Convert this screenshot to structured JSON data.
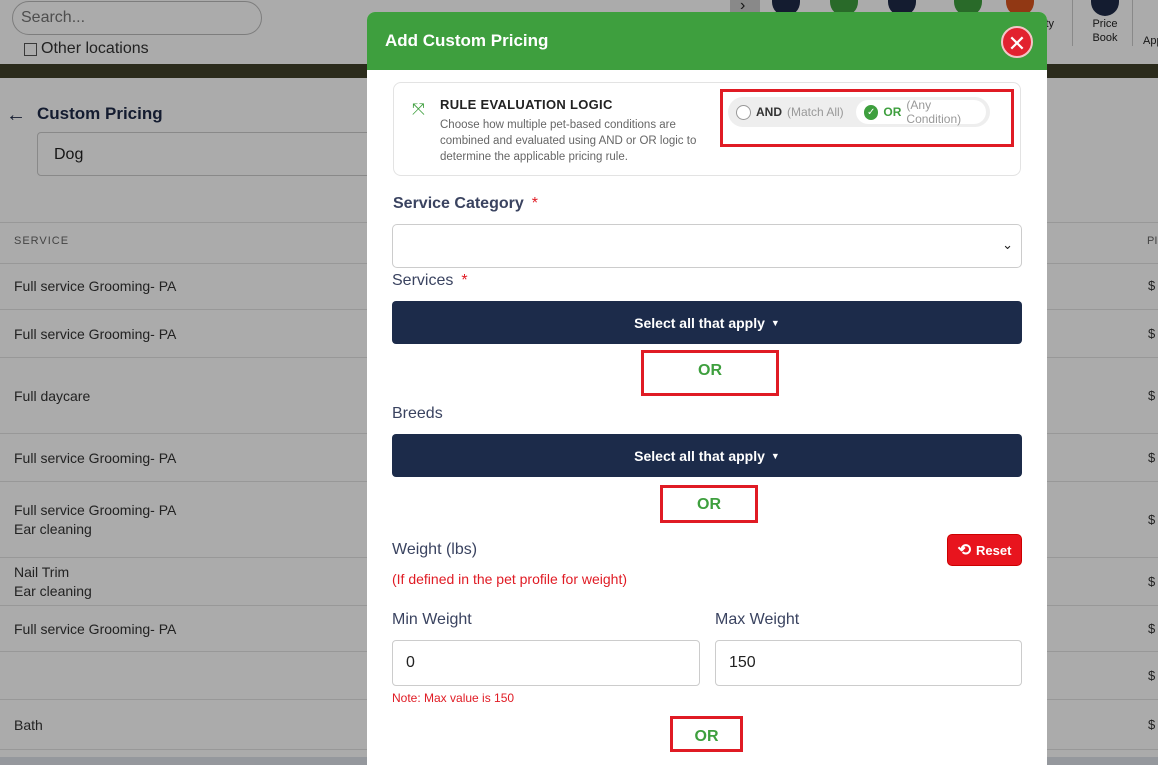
{
  "background": {
    "search_placeholder": "Search...",
    "other_locations_label": "Other locations",
    "top_nav": {
      "item_ability": "bility",
      "price_book_line1": "Price",
      "price_book_line2": "Book",
      "item_app": "App"
    },
    "page_title": "Custom Pricing",
    "pet_type_value": "Dog",
    "table": {
      "column_service": "SERVICE",
      "column_price_abbrev": "PI",
      "rows": [
        {
          "lines": [
            "Full service Grooming- PA"
          ],
          "price": "$"
        },
        {
          "lines": [
            "Full service Grooming- PA"
          ],
          "price": "$"
        },
        {
          "lines": [
            "Full daycare"
          ],
          "price": "$"
        },
        {
          "lines": [
            "Full service Grooming- PA"
          ],
          "price": "$"
        },
        {
          "lines": [
            "Full service Grooming- PA",
            "Ear cleaning"
          ],
          "price": "$"
        },
        {
          "lines": [
            "Nail Trim",
            "Ear cleaning"
          ],
          "price": "$"
        },
        {
          "lines": [
            "Full service Grooming- PA"
          ],
          "price": "$"
        },
        {
          "lines": [
            ""
          ],
          "price": "$"
        },
        {
          "lines": [
            "Bath"
          ],
          "price": "$"
        }
      ]
    }
  },
  "modal": {
    "title": "Add Custom Pricing",
    "close_symbol": "✕",
    "rule": {
      "title": "RULE EVALUATION LOGIC",
      "description": "Choose how multiple pet-based conditions are combined and evaluated using AND or OR logic to determine the applicable pricing rule.",
      "and_label": "AND",
      "and_hint": "(Match All)",
      "or_label": "OR",
      "or_hint": "(Any Condition)",
      "selected": "OR"
    },
    "service_category_label": "Service Category",
    "required_mark": "*",
    "services_label": "Services",
    "services_button": "Select all that apply",
    "or_separator": "OR",
    "breeds_label": "Breeds",
    "breeds_button": "Select all that apply",
    "weight_label": "Weight (lbs)",
    "weight_hint": "(If defined in the pet profile for weight)",
    "reset_label": "Reset",
    "min_weight_label": "Min Weight",
    "max_weight_label": "Max Weight",
    "min_weight_value": "0",
    "max_weight_value": "150",
    "max_note": "Note: Max value is 150"
  },
  "colors": {
    "header_green": "#3e9f3e",
    "navy_button": "#1c2b4a",
    "highlight_red": "#e01b24",
    "reset_red": "#e8141e"
  }
}
